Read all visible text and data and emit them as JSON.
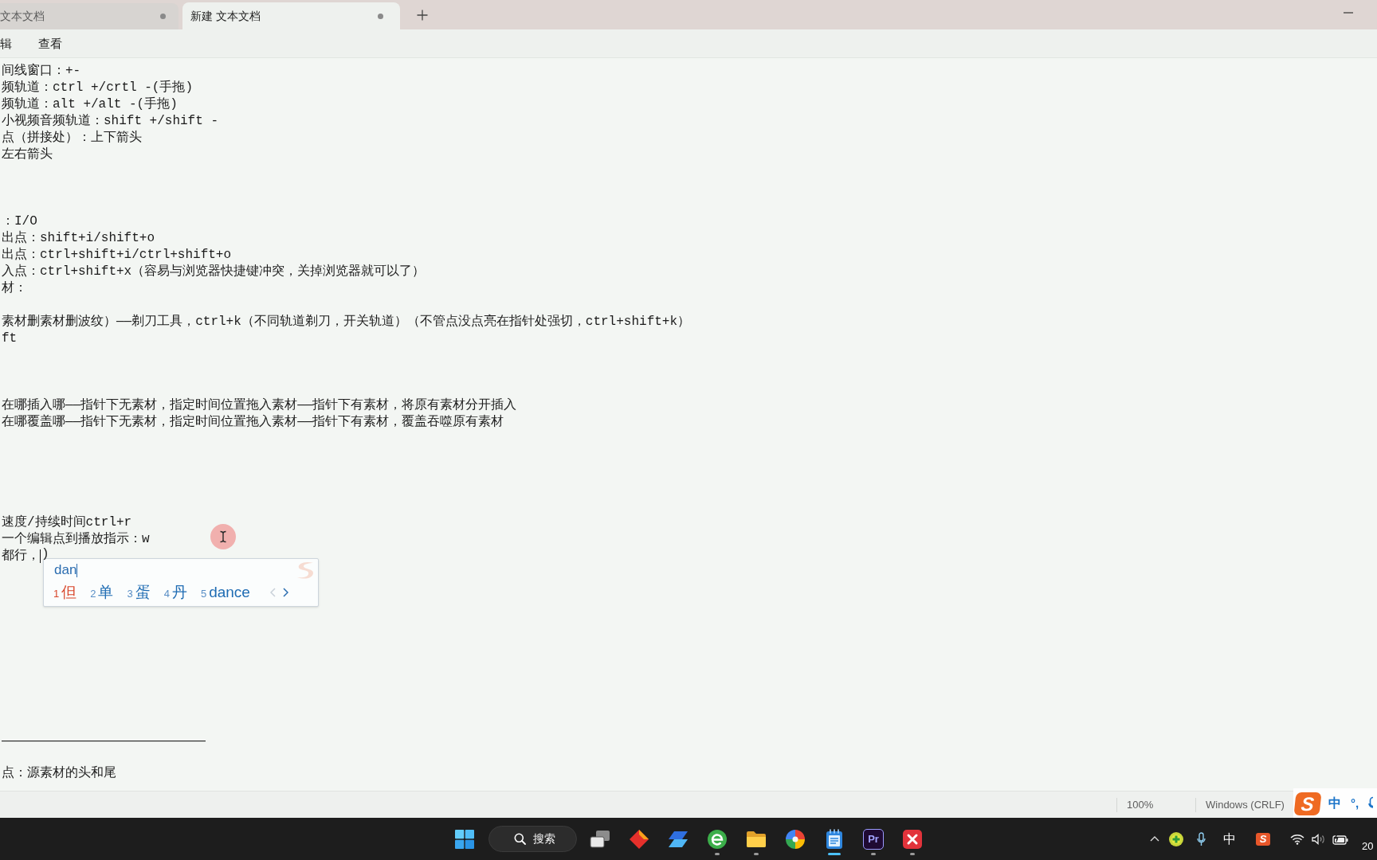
{
  "tabs": [
    {
      "title": "文本文档",
      "selected": false,
      "modified": true
    },
    {
      "title": "新建 文本文档",
      "selected": true,
      "modified": true
    }
  ],
  "menu": [
    {
      "label": "辑"
    },
    {
      "label": "查看"
    }
  ],
  "document": {
    "lines": [
      {
        "kind": "text",
        "text": "间线窗口：+-"
      },
      {
        "kind": "text",
        "text": "频轨道：ctrl +/crtl -(手拖)"
      },
      {
        "kind": "text",
        "text": "频轨道：alt +/alt -(手拖)"
      },
      {
        "kind": "text",
        "text": "小视频音频轨道：shift +/shift -"
      },
      {
        "kind": "text",
        "text": "点（拼接处）：上下箭头"
      },
      {
        "kind": "text",
        "text": "左右箭头"
      },
      {
        "kind": "blank"
      },
      {
        "kind": "blank"
      },
      {
        "kind": "blank"
      },
      {
        "kind": "text",
        "text": "：I/O"
      },
      {
        "kind": "text",
        "text": "出点：shift+i/shift+o"
      },
      {
        "kind": "text",
        "text": "出点：ctrl+shift+i/ctrl+shift+o"
      },
      {
        "kind": "text",
        "text": "入点：ctrl+shift+x（容易与浏览器快捷键冲突，关掉浏览器就可以了）"
      },
      {
        "kind": "text",
        "text": "材："
      },
      {
        "kind": "blank"
      },
      {
        "kind": "text",
        "text": "素材删素材删波纹）——剃刀工具，ctrl+k（不同轨道剃刀，开关轨道）（不管点没点亮在指针处强切，ctrl+shift+k）"
      },
      {
        "kind": "text",
        "text": "ft"
      },
      {
        "kind": "blank"
      },
      {
        "kind": "blank"
      },
      {
        "kind": "blank"
      },
      {
        "kind": "text",
        "text": "在哪插入哪——指针下无素材，指定时间位置拖入素材——指针下有素材，将原有素材分开插入"
      },
      {
        "kind": "text",
        "text": "在哪覆盖哪——指针下无素材，指定时间位置拖入素材——指针下有素材，覆盖吞噬原有素材"
      },
      {
        "kind": "blank"
      },
      {
        "kind": "blank"
      },
      {
        "kind": "blank"
      },
      {
        "kind": "blank"
      },
      {
        "kind": "blank"
      },
      {
        "kind": "text",
        "text": "速度/持续时间ctrl+r"
      },
      {
        "kind": "text",
        "text": "一个编辑点到播放指示：w"
      },
      {
        "kind": "editing",
        "text": "都行，",
        "after": ")"
      },
      {
        "kind": "blank"
      },
      {
        "kind": "blank"
      },
      {
        "kind": "blank"
      },
      {
        "kind": "blank"
      },
      {
        "kind": "blank"
      },
      {
        "kind": "blank"
      },
      {
        "kind": "blank"
      },
      {
        "kind": "blank"
      },
      {
        "kind": "blank"
      },
      {
        "kind": "blank"
      },
      {
        "kind": "rule",
        "text": "————————————————"
      },
      {
        "kind": "blank"
      },
      {
        "kind": "text",
        "text": "点：源素材的头和尾"
      }
    ]
  },
  "ime_popup": {
    "composition": "dan",
    "candidates": [
      {
        "number": "1",
        "text": "但",
        "selected": true
      },
      {
        "number": "2",
        "text": "单",
        "selected": false
      },
      {
        "number": "3",
        "text": "蛋",
        "selected": false
      },
      {
        "number": "4",
        "text": "丹",
        "selected": false
      },
      {
        "number": "5",
        "text": "dance",
        "selected": false
      }
    ],
    "prev_page": {
      "disabled": true
    },
    "next_page": {
      "disabled": false
    }
  },
  "status_bar": {
    "zoom": "100%",
    "line_ending": "Windows (CRLF)"
  },
  "ime_toolbar": {
    "logo": "S",
    "mode": "中",
    "punctuation": "°,"
  },
  "taskbar": {
    "search": {
      "label": "搜索"
    },
    "apps": [
      {
        "kind": "task_view",
        "running": false,
        "active": false
      },
      {
        "kind": "diamond",
        "running": false,
        "active": false
      },
      {
        "kind": "layers",
        "running": false,
        "active": false
      },
      {
        "kind": "swirl",
        "running": true,
        "active": false
      },
      {
        "kind": "folder",
        "running": true,
        "active": false
      },
      {
        "kind": "pinwheel",
        "running": false,
        "active": false
      },
      {
        "kind": "notepad",
        "running": true,
        "active": true
      },
      {
        "kind": "logo_text",
        "label": "Pr",
        "running": true,
        "active": false
      },
      {
        "kind": "cross",
        "running": true,
        "active": false
      }
    ],
    "tray": {
      "ime_mode": "中",
      "ime_logo": "S",
      "clock": "20"
    }
  }
}
